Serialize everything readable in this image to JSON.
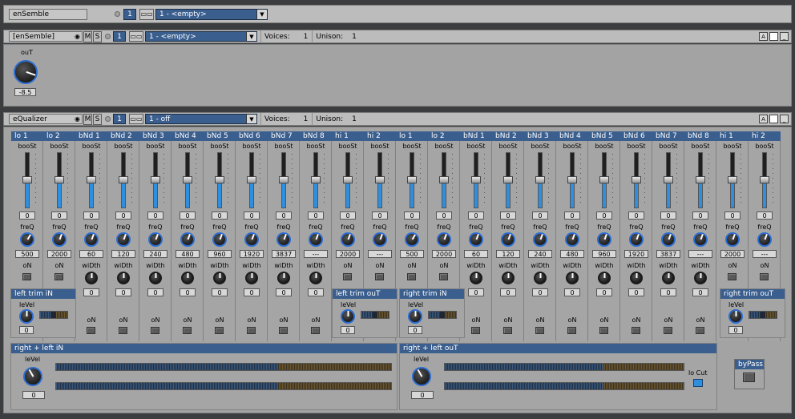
{
  "rack": {
    "name": "enSemble",
    "channel": "1",
    "preset": "1 - <empty>"
  },
  "ensemble": {
    "title": "[enSemble]",
    "mute": "M",
    "solo": "S",
    "channel": "1",
    "preset": "1 - <empty>",
    "voices_label": "Voices:",
    "voices": "1",
    "unison_label": "Unison:",
    "unison": "1",
    "win_a": "A",
    "win_min": "_",
    "out_label": "ouT",
    "out_value": "-8.5"
  },
  "equalizer": {
    "title": "eQualizer",
    "mute": "M",
    "solo": "S",
    "channel": "1",
    "preset": "1 - off",
    "voices_label": "Voices:",
    "voices": "1",
    "unison_label": "Unison:",
    "unison": "1",
    "win_a": "A",
    "win_min": "_"
  },
  "labels": {
    "boost": "booSt",
    "freq": "freQ",
    "on": "oN",
    "width": "wiDth",
    "level": "leVel"
  },
  "bands": [
    {
      "name": "lo 1",
      "boost": "0",
      "freq": "500",
      "width": null
    },
    {
      "name": "lo 2",
      "boost": "0",
      "freq": "2000",
      "width": null
    },
    {
      "name": "bNd 1",
      "boost": "0",
      "freq": "60",
      "width": "0"
    },
    {
      "name": "bNd 2",
      "boost": "0",
      "freq": "120",
      "width": "0"
    },
    {
      "name": "bNd 3",
      "boost": "0",
      "freq": "240",
      "width": "0"
    },
    {
      "name": "bNd 4",
      "boost": "0",
      "freq": "480",
      "width": "0"
    },
    {
      "name": "bNd 5",
      "boost": "0",
      "freq": "960",
      "width": "0"
    },
    {
      "name": "bNd 6",
      "boost": "0",
      "freq": "1920",
      "width": "0"
    },
    {
      "name": "bNd 7",
      "boost": "0",
      "freq": "3837",
      "width": "0"
    },
    {
      "name": "bNd 8",
      "boost": "0",
      "freq": "---",
      "width": "0"
    },
    {
      "name": "hi 1",
      "boost": "0",
      "freq": "2000",
      "width": null
    },
    {
      "name": "hi 2",
      "boost": "0",
      "freq": "---",
      "width": null
    },
    {
      "name": "lo 1",
      "boost": "0",
      "freq": "500",
      "width": null
    },
    {
      "name": "lo 2",
      "boost": "0",
      "freq": "2000",
      "width": null
    },
    {
      "name": "bNd 1",
      "boost": "0",
      "freq": "60",
      "width": "0"
    },
    {
      "name": "bNd 2",
      "boost": "0",
      "freq": "120",
      "width": "0"
    },
    {
      "name": "bNd 3",
      "boost": "0",
      "freq": "240",
      "width": "0"
    },
    {
      "name": "bNd 4",
      "boost": "0",
      "freq": "480",
      "width": "0"
    },
    {
      "name": "bNd 5",
      "boost": "0",
      "freq": "960",
      "width": "0"
    },
    {
      "name": "bNd 6",
      "boost": "0",
      "freq": "1920",
      "width": "0"
    },
    {
      "name": "bNd 7",
      "boost": "0",
      "freq": "3837",
      "width": "0"
    },
    {
      "name": "bNd 8",
      "boost": "0",
      "freq": "---",
      "width": "0"
    },
    {
      "name": "hi 1",
      "boost": "0",
      "freq": "2000",
      "width": null
    },
    {
      "name": "hi 2",
      "boost": "0",
      "freq": "---",
      "width": null
    }
  ],
  "trims": {
    "left_in": {
      "title": "left trim iN",
      "value": "0"
    },
    "left_out": {
      "title": "left trim ouT",
      "value": "0"
    },
    "right_in": {
      "title": "right trim iN",
      "value": "0"
    },
    "right_out": {
      "title": "right trim ouT",
      "value": "0"
    }
  },
  "io": {
    "in": {
      "title": "right + left iN",
      "value": "0"
    },
    "out": {
      "title": "right + left ouT",
      "value": "0"
    },
    "lo_cut": "lo Cut",
    "bypass": "byPass"
  },
  "colors": {
    "accent_blue": "#3a5e8e",
    "panel": "#a3a3a3",
    "knob_ring": "#2b6cd1"
  }
}
